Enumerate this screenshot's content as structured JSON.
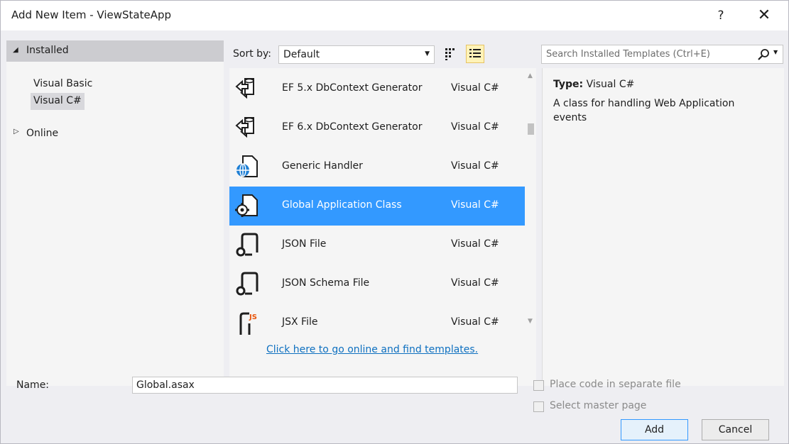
{
  "window": {
    "title": "Add New Item - ViewStateApp",
    "help_label": "?",
    "close_label": "✕"
  },
  "tree": {
    "installed_label": "Installed",
    "items": [
      {
        "label": "Visual Basic",
        "selected": false
      },
      {
        "label": "Visual C#",
        "selected": true
      }
    ],
    "online_label": "Online"
  },
  "toolbar": {
    "sort_label": "Sort by:",
    "sort_value": "Default",
    "search_placeholder": "Search Installed Templates (Ctrl+E)"
  },
  "templates": [
    {
      "name": "EF 5.x DbContext Generator",
      "language": "Visual C#",
      "icon": "ef-generator-icon",
      "selected": false
    },
    {
      "name": "EF 6.x DbContext Generator",
      "language": "Visual C#",
      "icon": "ef-generator-icon",
      "selected": false
    },
    {
      "name": "Generic Handler",
      "language": "Visual C#",
      "icon": "globe-file-icon",
      "selected": false
    },
    {
      "name": "Global Application Class",
      "language": "Visual C#",
      "icon": "gear-file-icon",
      "selected": true
    },
    {
      "name": "JSON File",
      "language": "Visual C#",
      "icon": "json-file-icon",
      "selected": false
    },
    {
      "name": "JSON Schema File",
      "language": "Visual C#",
      "icon": "json-file-icon",
      "selected": false
    },
    {
      "name": "JSX File",
      "language": "Visual C#",
      "icon": "jsx-file-icon",
      "selected": false
    }
  ],
  "online_link": "Click here to go online and find templates.",
  "details": {
    "type_label": "Type:",
    "type_value": "Visual C#",
    "description": "A class for handling Web Application events"
  },
  "bottom": {
    "name_label": "Name:",
    "name_value": "Global.asax",
    "place_code_label": "Place code in separate file",
    "master_page_label": "Select master page",
    "add_label": "Add",
    "cancel_label": "Cancel"
  },
  "colors": {
    "selection": "#3399ff",
    "link": "#0e70c0",
    "dialog_bg": "#eeeef2"
  }
}
